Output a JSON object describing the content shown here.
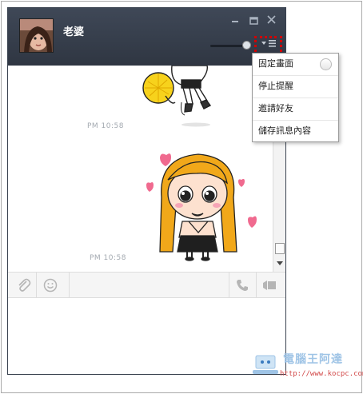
{
  "window": {
    "contact_name": "老婆",
    "controls": {
      "minimize_icon": "minimize-icon",
      "maximize_icon": "maximize-icon",
      "close_icon": "close-icon"
    },
    "menu_button_icon": "menu-icon"
  },
  "chat": {
    "messages": [
      {
        "type": "sticker",
        "sticker": "cheerleader-character"
      },
      {
        "timestamp": "PM 10:58"
      },
      {
        "type": "sticker",
        "sticker": "blonde-girl-hearts"
      },
      {
        "timestamp": "PM 10:58"
      }
    ]
  },
  "toolbar": {
    "attach_icon": "paperclip-icon",
    "emoji_icon": "smiley-icon",
    "call_icon": "phone-icon",
    "video_icon": "video-camera-icon"
  },
  "dropdown_menu": {
    "items": [
      {
        "label": "固定畫面",
        "has_toggle": true
      },
      {
        "label": "停止提醒"
      },
      {
        "label": "邀請好友"
      },
      {
        "label": "儲存訊息內容"
      }
    ]
  },
  "watermark": {
    "title": "電腦王阿達",
    "url": "http://www.kocpc.com.tw"
  },
  "colors": {
    "titlebar": "#333a46",
    "highlight_border": "#d10000",
    "timestamp": "#a3a9b0",
    "heart": "#f06a8f"
  }
}
